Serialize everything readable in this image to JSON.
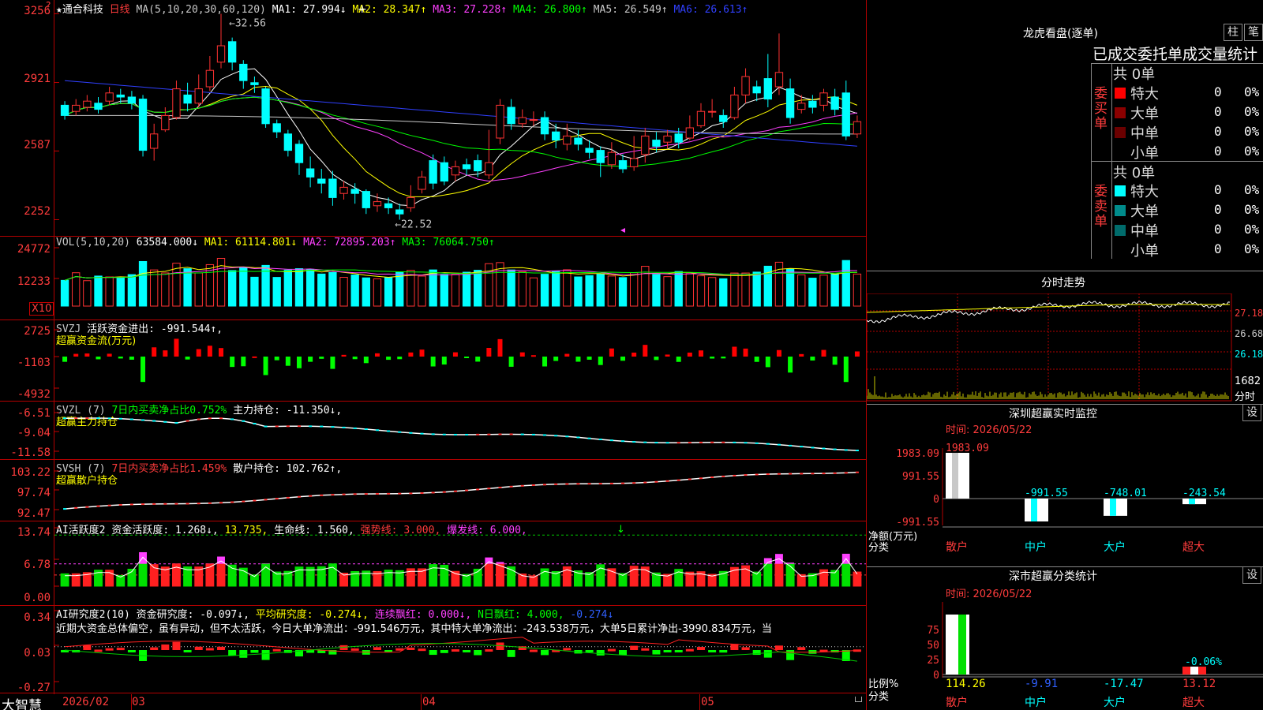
{
  "main": {
    "star": "★",
    "stock_name": "通合科技",
    "period": "日线",
    "ma_params": "MA(5,10,20,30,60,120)",
    "ma": [
      {
        "label": "MA1: 27.994↓",
        "color": "#ffffff"
      },
      {
        "label": "MA2: 28.347↑",
        "color": "#ffff00"
      },
      {
        "label": "MA3: 27.228↑",
        "color": "#ff40ff"
      },
      {
        "label": "MA4: 26.800↑",
        "color": "#00ff00"
      },
      {
        "label": "MA5: 26.549↑",
        "color": "#c8c8c8"
      },
      {
        "label": "MA6: 26.613↑",
        "color": "#3040ff"
      }
    ],
    "high_label": "32.56",
    "low_label": "22.52",
    "y_labels": [
      "3256",
      "2921",
      "2587",
      "2252"
    ],
    "marker_q": "?"
  },
  "vol": {
    "title": "VOL(5,10,20)",
    "value": "63584.000↓",
    "ma": [
      {
        "label": "MA1: 61114.801↓",
        "color": "#ffff00"
      },
      {
        "label": "MA2: 72895.203↑",
        "color": "#ff40ff"
      },
      {
        "label": "MA3: 76064.750↑",
        "color": "#00ff00"
      }
    ],
    "y_labels": [
      "24772",
      "12233"
    ],
    "unit": "X10"
  },
  "svzj": {
    "title": "SVZJ",
    "value": "活跃资金进出: -991.544↑,",
    "subtitle": "超赢资金流(万元)",
    "y_labels": [
      "2725",
      "-1103",
      "-4932"
    ]
  },
  "svzl": {
    "title": "SVZL (7)",
    "ratio": "7日内买卖净占比0.752%",
    "value": "主力持仓: -11.350↓,",
    "subtitle": "超赢主力持仓",
    "y_labels": [
      "-6.51",
      "-9.04",
      "-11.58"
    ]
  },
  "svsh": {
    "title": "SVSH (7)",
    "ratio": "7日内买卖净占比1.459%",
    "value": "散户持仓: 102.762↑,",
    "subtitle": "超赢散户持仓",
    "y_labels": [
      "103.22",
      "97.74",
      "92.47"
    ]
  },
  "ai_active": {
    "title": "AI活跃度2",
    "items": [
      {
        "label": "资金活跃度: 1.268↓,",
        "color": "#ffffff"
      },
      {
        "label": "13.735,",
        "color": "#ffff00"
      },
      {
        "label": "生命线: 1.560,",
        "color": "#ffffff"
      },
      {
        "label": "强势线: 3.000,",
        "color": "#ff3c3c"
      },
      {
        "label": "爆发线: 6.000,",
        "color": "#ff40ff"
      }
    ],
    "y_labels": [
      "13.74",
      "6.78",
      "0.00"
    ]
  },
  "ai_research": {
    "title": "AI研究度2(10)",
    "items": [
      {
        "label": "资金研究度: -0.097↓,",
        "color": "#ffffff"
      },
      {
        "label": "平均研究度: -0.274↓,",
        "color": "#ffff00"
      },
      {
        "label": "连续飘红: 0.000↓,",
        "color": "#ff40ff"
      },
      {
        "label": "N日飘红: 4.000,",
        "color": "#00ff00"
      },
      {
        "label": "-0.274↓",
        "color": "#3060ff"
      }
    ],
    "summary": "近期大资金总体偏空，虽有异动，但不太活跃，今日大单净流出：-991.546万元，其中特大单净流出：-243.538万元，大单5日累计净出-3990.834万元，当",
    "y_labels": [
      "0.34",
      "0.03",
      "-0.27"
    ]
  },
  "bottom": {
    "app": "大智慧",
    "dates": [
      "2026/02",
      "03",
      "04",
      "05"
    ]
  },
  "right": {
    "lhb_title": "龙虎看盘(逐单)",
    "btn_col": "柱",
    "btn_pen": "笔",
    "stats_title": "已成交委托单成交量统计",
    "buy_group": "委买单",
    "sell_group": "委卖单",
    "buy_total": "共 0单",
    "sell_total": "共 0单",
    "buy_rows": [
      {
        "label": "特大",
        "value": "0",
        "pct": "0%",
        "color": "#ff0000"
      },
      {
        "label": "大单",
        "value": "0",
        "pct": "0%",
        "color": "#8b0000"
      },
      {
        "label": "中单",
        "value": "0",
        "pct": "0%",
        "color": "#6b0000"
      },
      {
        "label": "小单",
        "value": "0",
        "pct": "0%",
        "color": ""
      }
    ],
    "sell_rows": [
      {
        "label": "特大",
        "value": "0",
        "pct": "0%",
        "color": "#00ffff"
      },
      {
        "label": "大单",
        "value": "0",
        "pct": "0%",
        "color": "#008b8b"
      },
      {
        "label": "中单",
        "value": "0",
        "pct": "0%",
        "color": "#006b6b"
      },
      {
        "label": "小单",
        "value": "0",
        "pct": "0%",
        "color": ""
      }
    ],
    "intraday_title": "分时走势",
    "intraday_y": [
      "27.18",
      "26.68",
      "26.18"
    ],
    "intraday_vol": "1682",
    "intraday_vol_unit": "分时",
    "sz_title": "深圳超赢实时监控",
    "sz_btn": "设",
    "sz_time": "时间: 2026/05/22",
    "sz_y": [
      "1983.09",
      "991.55",
      "0",
      "-991.55"
    ],
    "sz_bar_labels": [
      "1983.09",
      "-991.55",
      "-748.01",
      "-243.54"
    ],
    "sz_units": [
      "净额(万元)",
      "分类"
    ],
    "sz_cats": [
      "散户",
      "中户",
      "大户",
      "超大"
    ],
    "ss_title": "深市超赢分类统计",
    "ss_btn": "设",
    "ss_time": "时间: 2026/05/22",
    "ss_y": [
      "75",
      "50",
      "25",
      "0"
    ],
    "ss_top_label": "-0.06%",
    "ss_units": [
      "比例%",
      "分类"
    ],
    "ss_values": [
      "114.26",
      "-9.91",
      "-17.47",
      "13.12"
    ],
    "ss_cats": [
      "散户",
      "中户",
      "大户",
      "超大"
    ]
  },
  "chart_data": [
    {
      "type": "candlestick",
      "title": "通合科技 日线",
      "ylim": [
        22.0,
        33.0
      ],
      "y_ticks": [
        32.56,
        29.21,
        25.87,
        22.52
      ],
      "candles": [
        [
          28.1,
          27.6,
          28.3,
          27.4
        ],
        [
          27.8,
          28.1,
          28.4,
          27.6
        ],
        [
          28.0,
          28.3,
          28.6,
          27.8
        ],
        [
          28.2,
          27.9,
          28.5,
          27.7
        ],
        [
          28.3,
          28.7,
          29.0,
          28.1
        ],
        [
          28.6,
          28.5,
          28.9,
          28.2
        ],
        [
          28.5,
          28.2,
          28.8,
          27.9
        ],
        [
          28.4,
          25.9,
          28.6,
          25.6
        ],
        [
          26.0,
          26.7,
          27.2,
          25.4
        ],
        [
          26.9,
          27.6,
          28.0,
          26.8
        ],
        [
          27.5,
          28.9,
          29.3,
          27.4
        ],
        [
          28.6,
          28.2,
          29.2,
          27.8
        ],
        [
          28.2,
          28.9,
          29.6,
          28.0
        ],
        [
          29.0,
          29.8,
          30.5,
          28.8
        ],
        [
          30.2,
          31.0,
          32.56,
          29.9
        ],
        [
          31.2,
          30.2,
          31.4,
          29.8
        ],
        [
          30.1,
          29.3,
          30.3,
          28.9
        ],
        [
          29.2,
          29.1,
          29.5,
          28.7
        ],
        [
          28.9,
          27.2,
          29.0,
          27.0
        ],
        [
          27.2,
          26.8,
          27.4,
          26.5
        ],
        [
          26.7,
          25.9,
          26.9,
          25.6
        ],
        [
          26.2,
          25.3,
          26.4,
          24.7
        ],
        [
          25.0,
          24.6,
          25.6,
          24.1
        ],
        [
          24.5,
          24.3,
          25.0,
          23.8
        ],
        [
          24.5,
          23.6,
          24.9,
          23.2
        ],
        [
          23.8,
          24.1,
          24.4,
          23.5
        ],
        [
          24.0,
          23.8,
          24.3,
          23.3
        ],
        [
          23.9,
          23.1,
          24.0,
          22.8
        ],
        [
          23.2,
          23.4,
          23.8,
          22.9
        ],
        [
          23.3,
          23.1,
          23.6,
          22.8
        ],
        [
          23.0,
          22.8,
          23.3,
          22.52
        ],
        [
          23.1,
          23.6,
          24.2,
          22.9
        ],
        [
          24.0,
          24.6,
          24.9,
          23.8
        ],
        [
          25.4,
          24.3,
          25.7,
          24.0
        ],
        [
          25.3,
          24.4,
          25.6,
          24.2
        ],
        [
          24.7,
          25.1,
          25.4,
          24.4
        ],
        [
          25.2,
          25.0,
          25.5,
          24.7
        ],
        [
          25.4,
          24.9,
          25.7,
          24.6
        ],
        [
          24.7,
          25.3,
          26.9,
          24.5
        ],
        [
          26.5,
          28.1,
          28.4,
          26.2
        ],
        [
          28.0,
          27.2,
          28.4,
          26.9
        ],
        [
          27.2,
          27.5,
          27.9,
          27.0
        ],
        [
          27.4,
          27.4,
          27.8,
          27.1
        ],
        [
          27.5,
          26.7,
          27.8,
          26.4
        ],
        [
          26.8,
          26.4,
          27.2,
          26.0
        ],
        [
          26.2,
          26.6,
          27.2,
          25.9
        ],
        [
          26.5,
          26.2,
          26.9,
          25.9
        ],
        [
          26.0,
          25.8,
          26.4,
          25.5
        ],
        [
          25.9,
          25.3,
          26.1,
          24.6
        ],
        [
          25.2,
          25.8,
          26.3,
          25.0
        ],
        [
          25.4,
          25.0,
          25.7,
          24.8
        ],
        [
          25.1,
          25.5,
          26.6,
          24.9
        ],
        [
          25.7,
          26.6,
          27.0,
          25.3
        ],
        [
          26.4,
          26.1,
          26.8,
          25.8
        ],
        [
          26.3,
          26.6,
          26.9,
          26.0
        ],
        [
          26.7,
          26.3,
          27.0,
          26.0
        ],
        [
          26.5,
          27.0,
          27.6,
          26.4
        ],
        [
          27.1,
          27.8,
          28.2,
          27.0
        ],
        [
          27.8,
          27.8,
          28.4,
          27.5
        ],
        [
          27.6,
          27.3,
          27.9,
          27.0
        ],
        [
          27.5,
          28.6,
          29.0,
          27.4
        ],
        [
          28.6,
          29.5,
          29.9,
          28.2
        ],
        [
          29.0,
          28.7,
          29.3,
          28.3
        ],
        [
          29.4,
          28.4,
          30.6,
          28.0
        ],
        [
          29.0,
          29.7,
          31.6,
          28.6
        ],
        [
          28.9,
          27.5,
          29.4,
          27.2
        ],
        [
          27.9,
          28.2,
          28.6,
          27.7
        ],
        [
          28.3,
          28.0,
          28.6,
          27.7
        ],
        [
          28.1,
          28.7,
          28.9,
          27.8
        ],
        [
          28.5,
          27.9,
          28.9,
          27.6
        ],
        [
          28.7,
          26.6,
          29.3,
          26.4
        ],
        [
          26.7,
          27.3,
          27.6,
          26.5
        ]
      ]
    }
  ]
}
